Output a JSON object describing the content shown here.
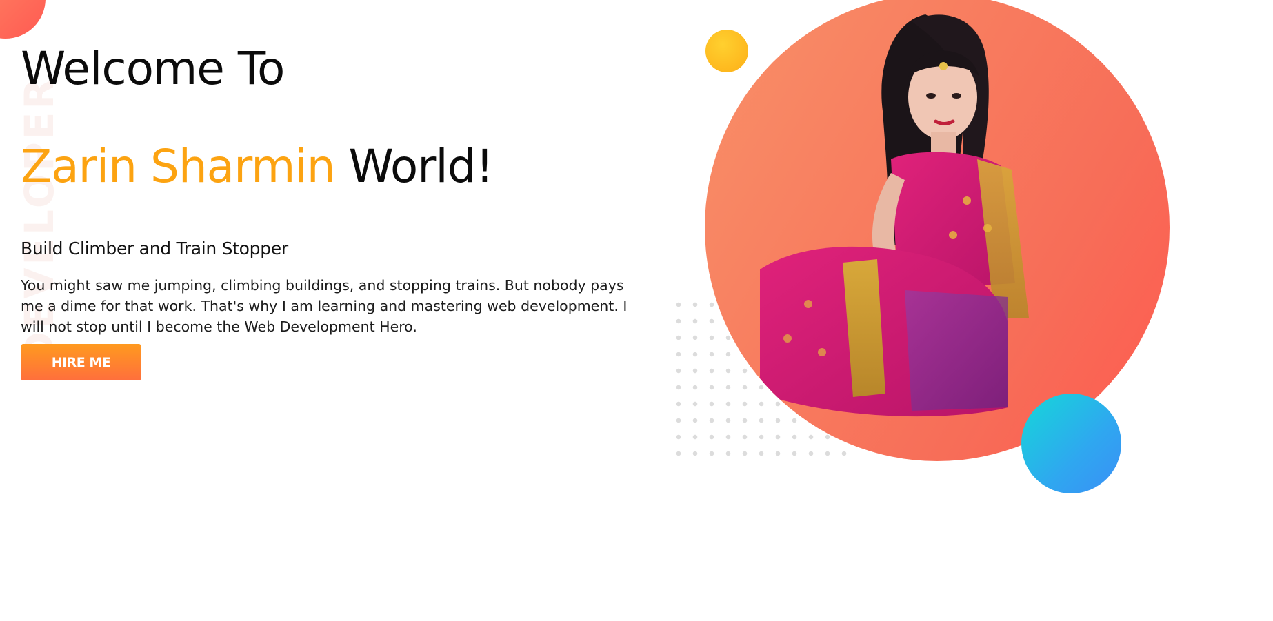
{
  "watermark": {
    "text": "DEVELOPER"
  },
  "hero": {
    "welcome": "Welcome To",
    "name_highlight": "Zarin Sharmin",
    "name_rest": " World!",
    "tagline": "Build Climber and Train Stopper",
    "bio": "You might saw me jumping, climbing buildings, and stopping trains. But nobody pays me a dime for that work. That's why I am learning and mastering web development. I will not stop until I become the Web Development Hero.",
    "hire_button_label": "HIRE ME"
  },
  "colors": {
    "accent_orange": "#fca311",
    "button_gradient_start": "#ff9a1f",
    "button_gradient_end": "#ff6f3c",
    "circle_coral": "#f76d58",
    "yellow_dot": "#fdb51c",
    "blue_dot": "#2fa7f0"
  },
  "portrait": {
    "icon": "profile-photo"
  }
}
